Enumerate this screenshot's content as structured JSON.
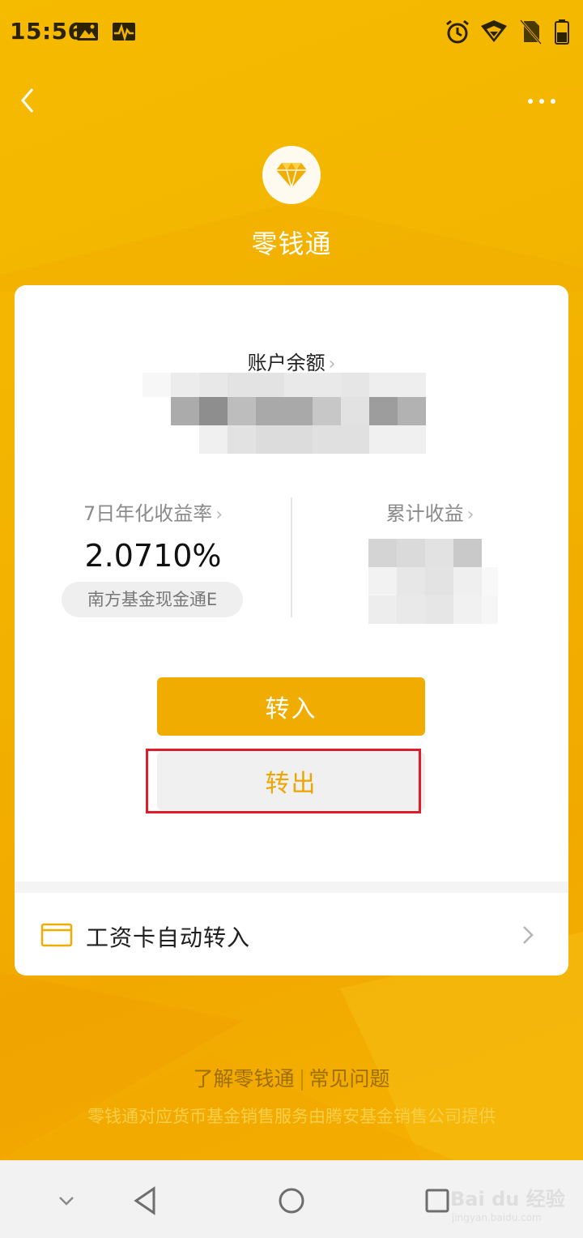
{
  "status_bar": {
    "time": "15:56",
    "icons": [
      "image-icon",
      "activity-icon",
      "alarm-icon",
      "wifi-icon",
      "no-sim-icon",
      "battery-icon"
    ]
  },
  "nav": {
    "back_icon": "chevron-left-icon",
    "more_icon": "more-dots-icon"
  },
  "header": {
    "logo_icon": "diamond-icon",
    "title": "零钱通"
  },
  "card": {
    "balance_label": "账户余额",
    "balance_chevron": "›",
    "yield_label": "7日年化收益率",
    "yield_value": "2.0710%",
    "fund_name": "南方基金现金通E",
    "cumulative_label": "累计收益",
    "btn_in": "转入",
    "btn_out": "转出",
    "salary_label": "工资卡自动转入"
  },
  "footer": {
    "link_learn": "了解零钱通",
    "link_faq": "常见问题",
    "note": "零钱通对应货币基金销售服务由腾安基金销售公司提供"
  },
  "system_nav": {
    "watermark_main": "Bai du 经验",
    "watermark_sub": "jingyan.baidu.com"
  },
  "colors": {
    "brand": "#f3b400",
    "button_in": "#f0ac00",
    "button_out_text": "#eea500",
    "highlight": "#e01b2a"
  }
}
